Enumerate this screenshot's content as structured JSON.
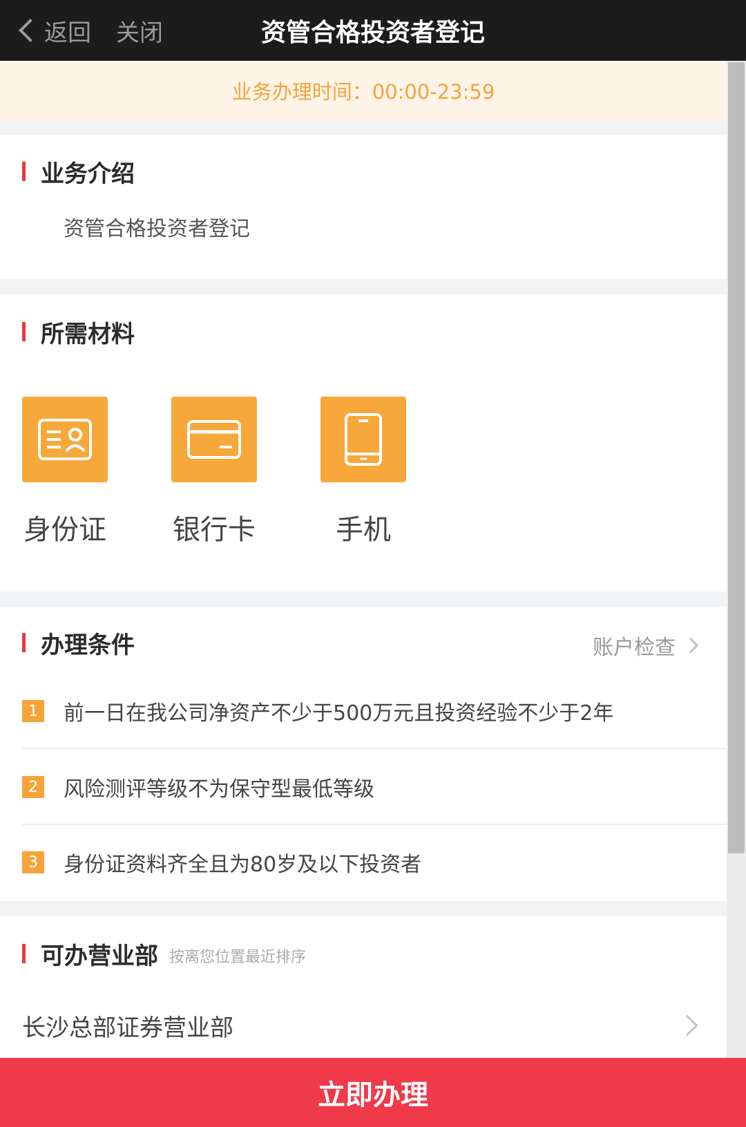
{
  "nav": {
    "back_label": "返回",
    "close_label": "关闭",
    "title": "资管合格投资者登记"
  },
  "hours_banner": "业务办理时间：00:00-23:59",
  "intro": {
    "title": "业务介绍",
    "text": "资管合格投资者登记"
  },
  "materials": {
    "title": "所需材料",
    "items": [
      {
        "label": "身份证",
        "icon": "id-card-icon"
      },
      {
        "label": "银行卡",
        "icon": "bank-card-icon"
      },
      {
        "label": "手机",
        "icon": "mobile-phone-icon"
      }
    ]
  },
  "conditions": {
    "title": "办理条件",
    "account_check_label": "账户检查",
    "items": [
      {
        "num": "1",
        "text": "前一日在我公司净资产不少于500万元且投资经验不少于2年"
      },
      {
        "num": "2",
        "text": "风险测评等级不为保守型最低等级"
      },
      {
        "num": "3",
        "text": "身份证资料齐全且为80岁及以下投资者"
      }
    ]
  },
  "branches": {
    "title": "可办营业部",
    "subtitle": "按离您位置最近排序",
    "items": [
      {
        "name": "长沙总部证券营业部"
      }
    ]
  },
  "cta_label": "立即办理",
  "colors": {
    "accent_red": "#ef3a4a",
    "accent_orange": "#f7a83a",
    "banner_text": "#f5a33b"
  }
}
